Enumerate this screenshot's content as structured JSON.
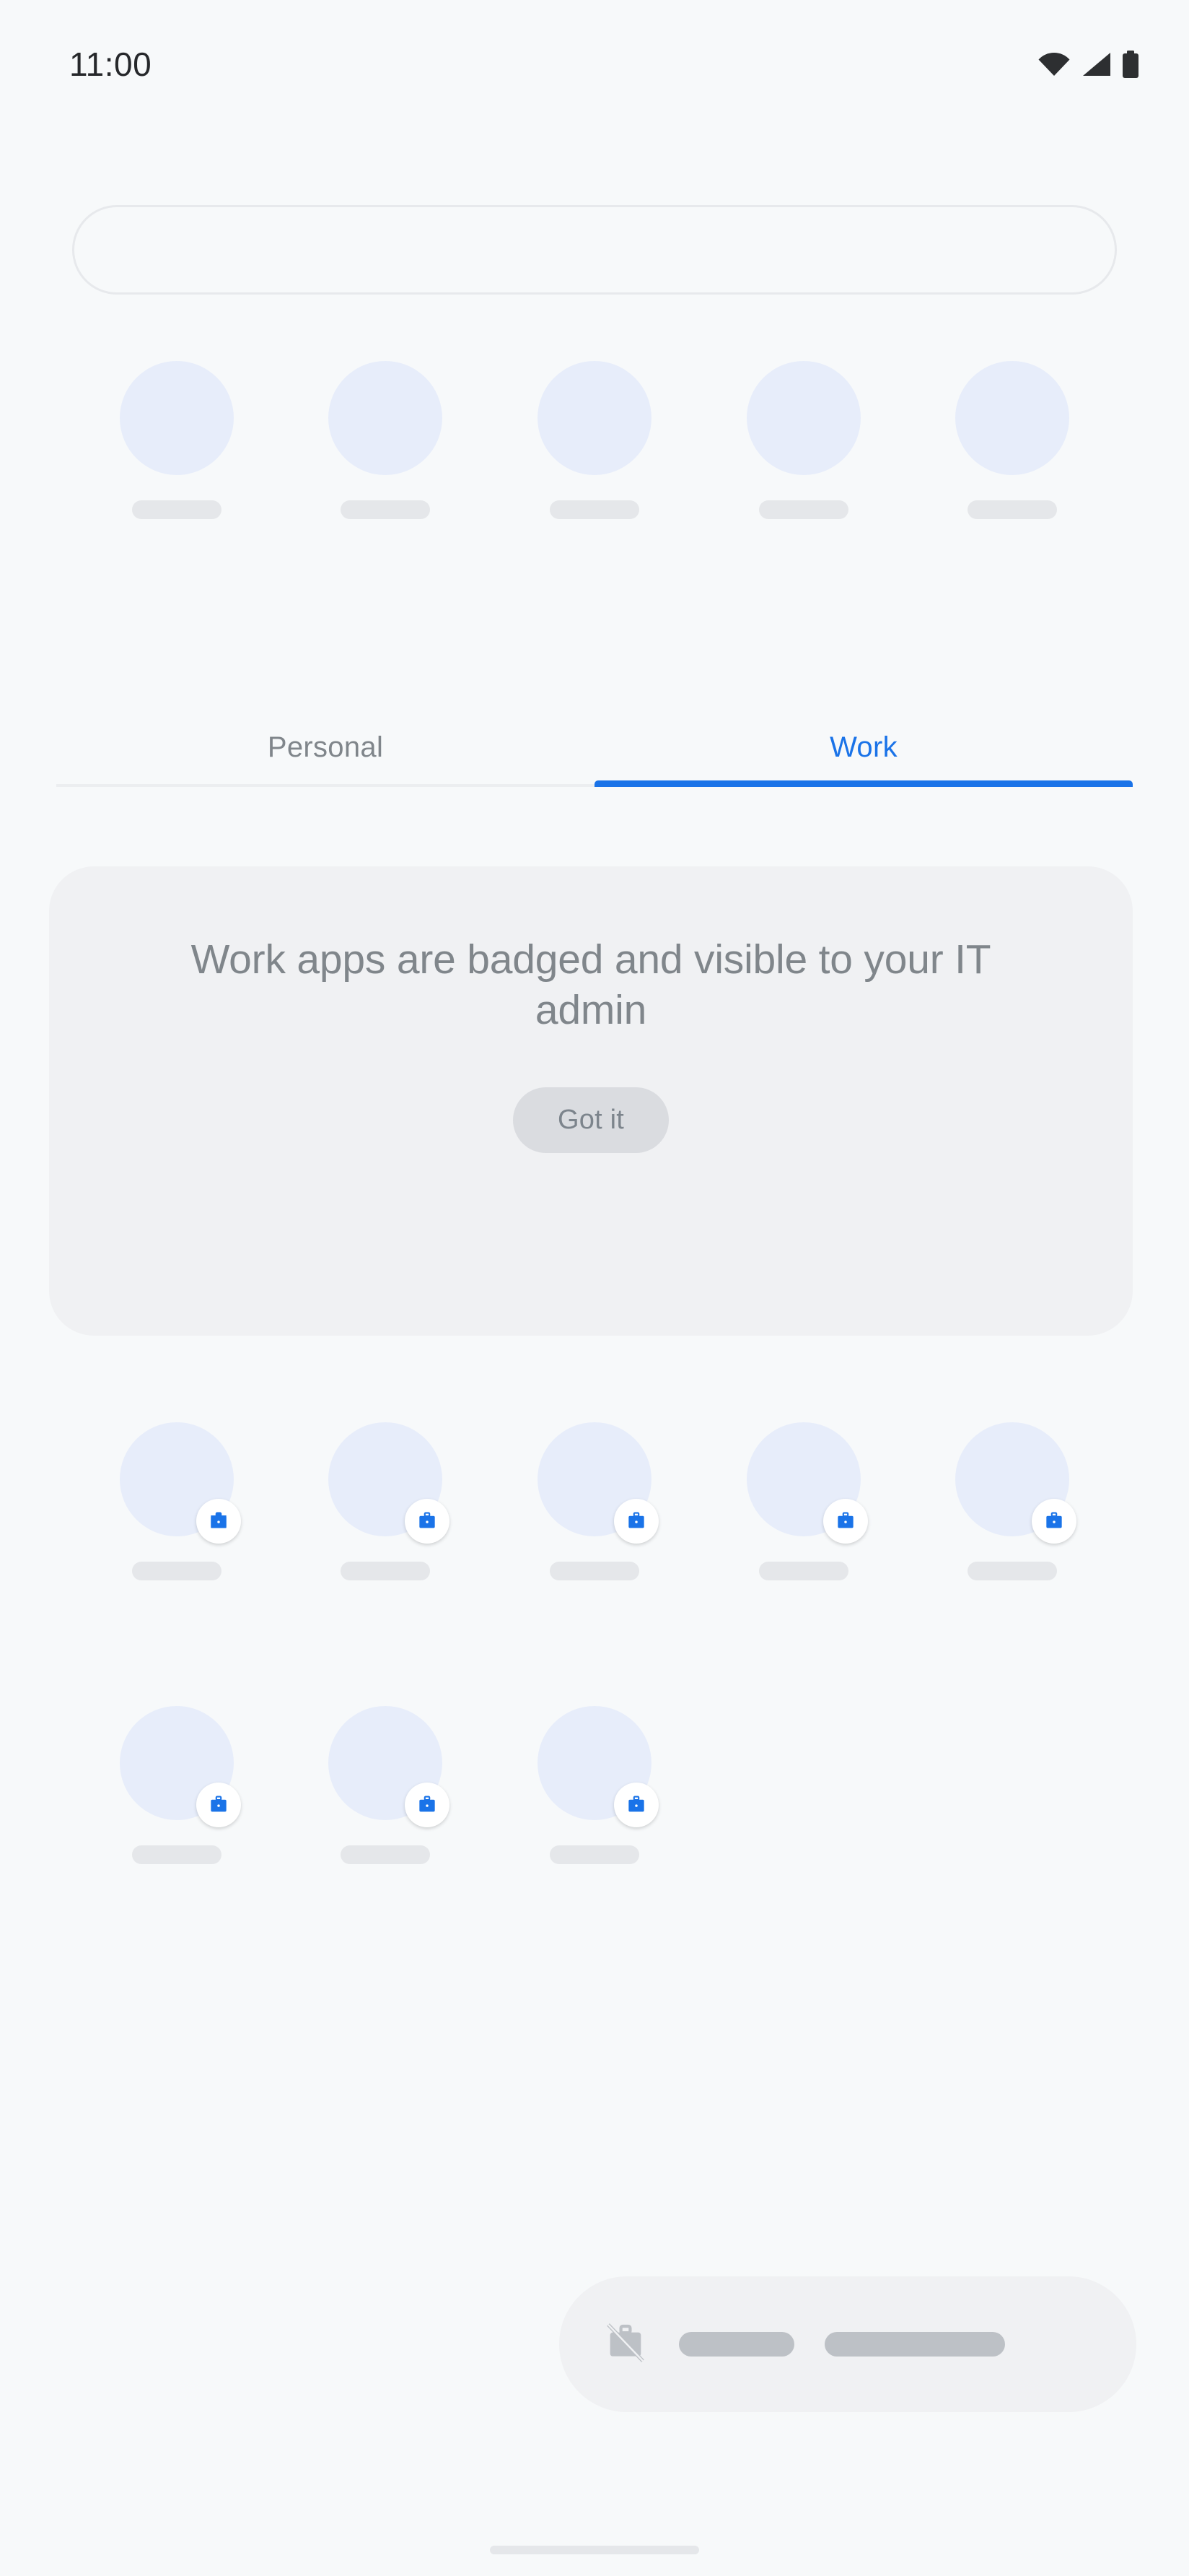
{
  "status_bar": {
    "time": "11:00",
    "icons": [
      "wifi-icon",
      "cellular-signal-icon",
      "battery-icon"
    ]
  },
  "search": {
    "value": "",
    "placeholder": ""
  },
  "colors": {
    "background": "#f7f9fa",
    "accent_blue": "#1a73e8",
    "app_icon_placeholder": "#e7edfa",
    "label_placeholder": "#e5e7ea",
    "card_background": "#f0f1f3",
    "button_background": "#dadce0",
    "muted_text": "#80868b",
    "bar_pill": "#bdc1c6"
  },
  "personal_apps": [
    {
      "label": "",
      "badged": false
    },
    {
      "label": "",
      "badged": false
    },
    {
      "label": "",
      "badged": false
    },
    {
      "label": "",
      "badged": false
    },
    {
      "label": "",
      "badged": false
    }
  ],
  "tabs": [
    {
      "label": "Personal",
      "active": false
    },
    {
      "label": "Work",
      "active": true
    }
  ],
  "info_card": {
    "title": "Work apps are badged and visible to your IT admin",
    "button_label": "Got it"
  },
  "work_apps_row1": [
    {
      "label": "",
      "badged": true
    },
    {
      "label": "",
      "badged": true
    },
    {
      "label": "",
      "badged": true
    },
    {
      "label": "",
      "badged": true
    },
    {
      "label": "",
      "badged": true
    }
  ],
  "work_apps_row2": [
    {
      "label": "",
      "badged": true
    },
    {
      "label": "",
      "badged": true
    },
    {
      "label": "",
      "badged": true
    }
  ],
  "bottom_bar": {
    "icon": "work-apps-off-icon",
    "pill_1": "",
    "pill_2": ""
  },
  "home_indicator": {
    "label": ""
  }
}
